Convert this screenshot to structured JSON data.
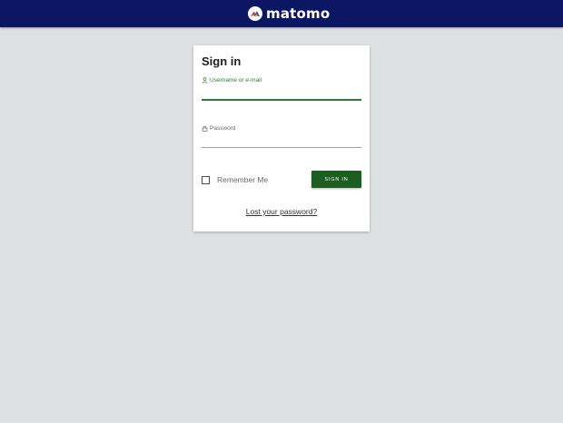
{
  "header": {
    "brand_name": "matomo",
    "background_color": "#0c1764",
    "logo_icon": "matomo-logo-icon"
  },
  "login": {
    "title": "Sign in",
    "username": {
      "label": "Username or e-mail",
      "value": "",
      "icon": "user-icon",
      "accent_color": "#2e7d32"
    },
    "password": {
      "label": "Password",
      "value": "",
      "icon": "lock-icon"
    },
    "remember_me": {
      "label": "Remember Me",
      "checked": false
    },
    "submit_label": "SIGN IN",
    "submit_color": "#1b5e20",
    "lost_password_label": "Lost your password?"
  }
}
